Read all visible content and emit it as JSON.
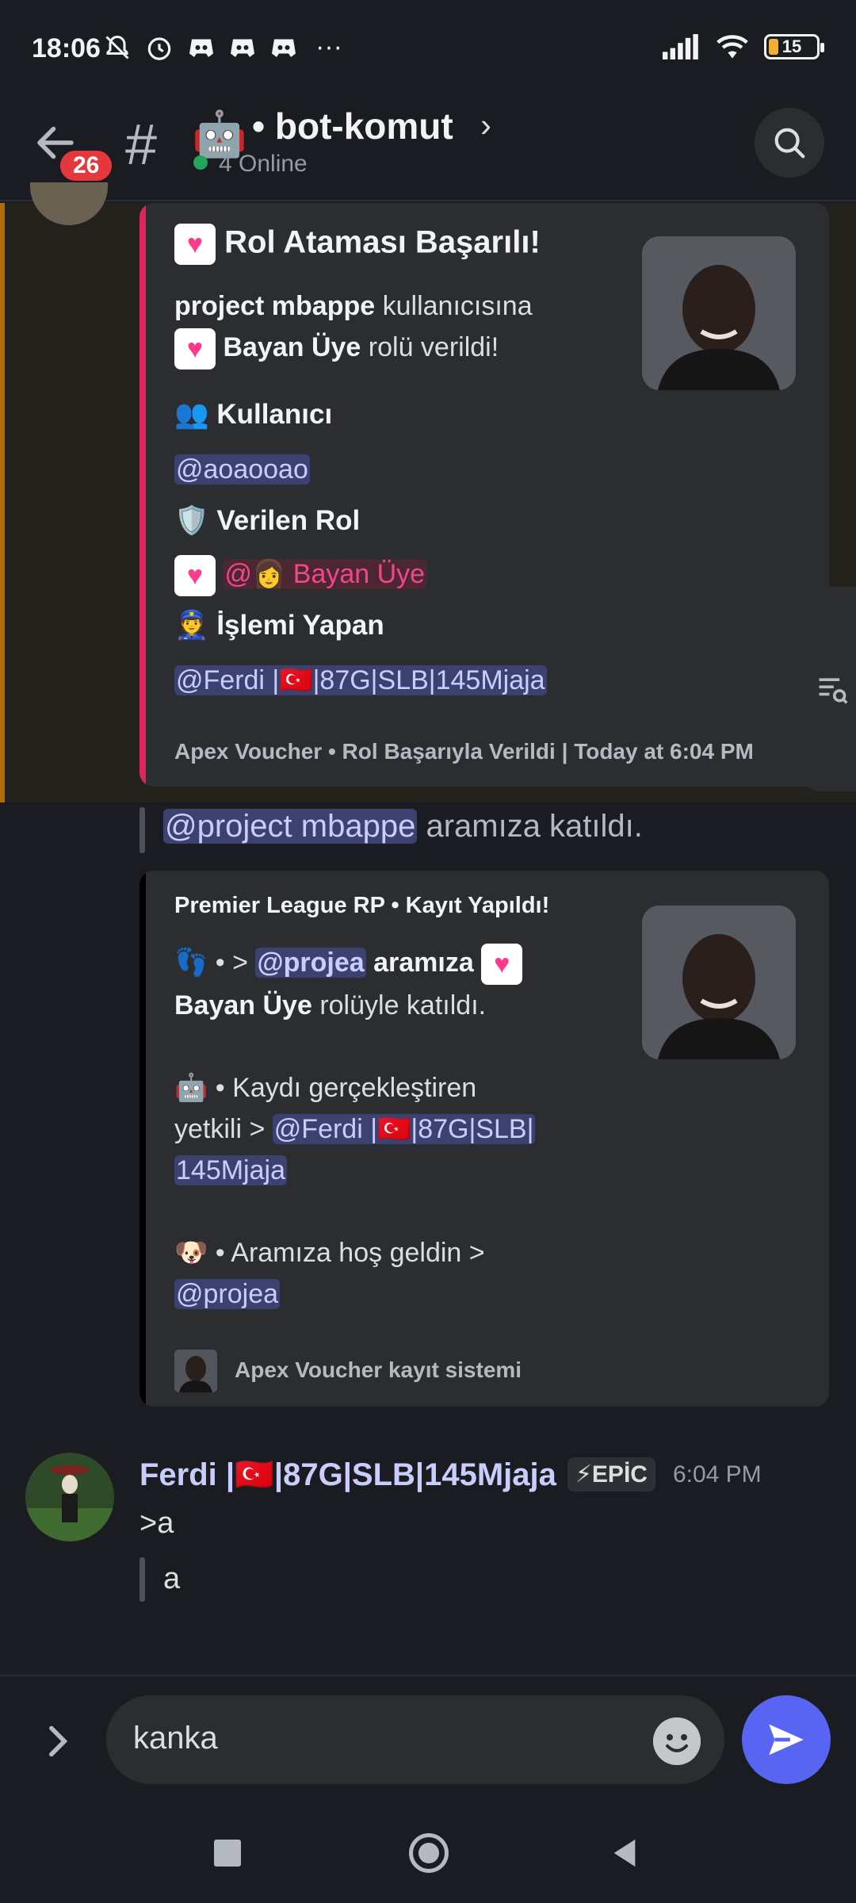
{
  "status_bar": {
    "time": "18:06",
    "more": "···",
    "battery": "15"
  },
  "header": {
    "unread_badge": "26",
    "hash": "#",
    "channel_emoji": "🤖",
    "channel_name": "• bot-komut",
    "online": "4 Online"
  },
  "embed1": {
    "title": "Rol Ataması Başarılı!",
    "user_bold": "project mbappe",
    "line1_rest": "kullanıcısına",
    "role_bold": "Bayan Üye",
    "line2_rest": "rolü verildi!",
    "field1_name": "Kullanıcı",
    "field1_value": "@aoaooao",
    "field2_name": "Verilen Rol",
    "field2_value_prefix": "@",
    "field2_value_emoji": "👩",
    "field2_value": "Bayan Üye",
    "field3_name": "İşlemi Yapan",
    "field3_value": "@Ferdi |🇹🇷|87G|SLB|145Mjaja",
    "footer": "Apex Voucher • Rol Başarıyla Verildi | Today at 6:04 PM",
    "icon_user": "👥",
    "icon_shield": "🛡️",
    "icon_officer": "👮"
  },
  "join_message": {
    "mention": "@project mbappe",
    "text": "aramıza katıldı."
  },
  "embed2": {
    "title": "Premier League RP • Kayıt Yapıldı!",
    "line1_pre": "• >",
    "line1_mention": "@projea",
    "line1_bold": "aramıza",
    "line2_bold": "Bayan Üye",
    "line2_rest": "rolüyle katıldı.",
    "line3": "• Kaydı gerçekleştiren",
    "line4_pre": "yetkili >",
    "line4_mention": "@Ferdi |🇹🇷|87G|SLB|",
    "line5_mention": "145Mjaja",
    "line6": "• Aramıza hoş geldin >",
    "line7_mention": "@projea",
    "footer": "Apex Voucher kayıt sistemi"
  },
  "message": {
    "author": "Ferdi |🇹🇷|87G|SLB|145Mjaja",
    "role_tag": "⚡EPİC",
    "timestamp": "6:04 PM",
    "line1": ">a",
    "quote": "a"
  },
  "input": {
    "value": "kanka"
  },
  "colors": {
    "accent": "#5865f2",
    "embed1_border": "#e0245e",
    "embed2_border": "#000000",
    "highlight_bar": "#b06e0b",
    "online": "#23a55a"
  }
}
